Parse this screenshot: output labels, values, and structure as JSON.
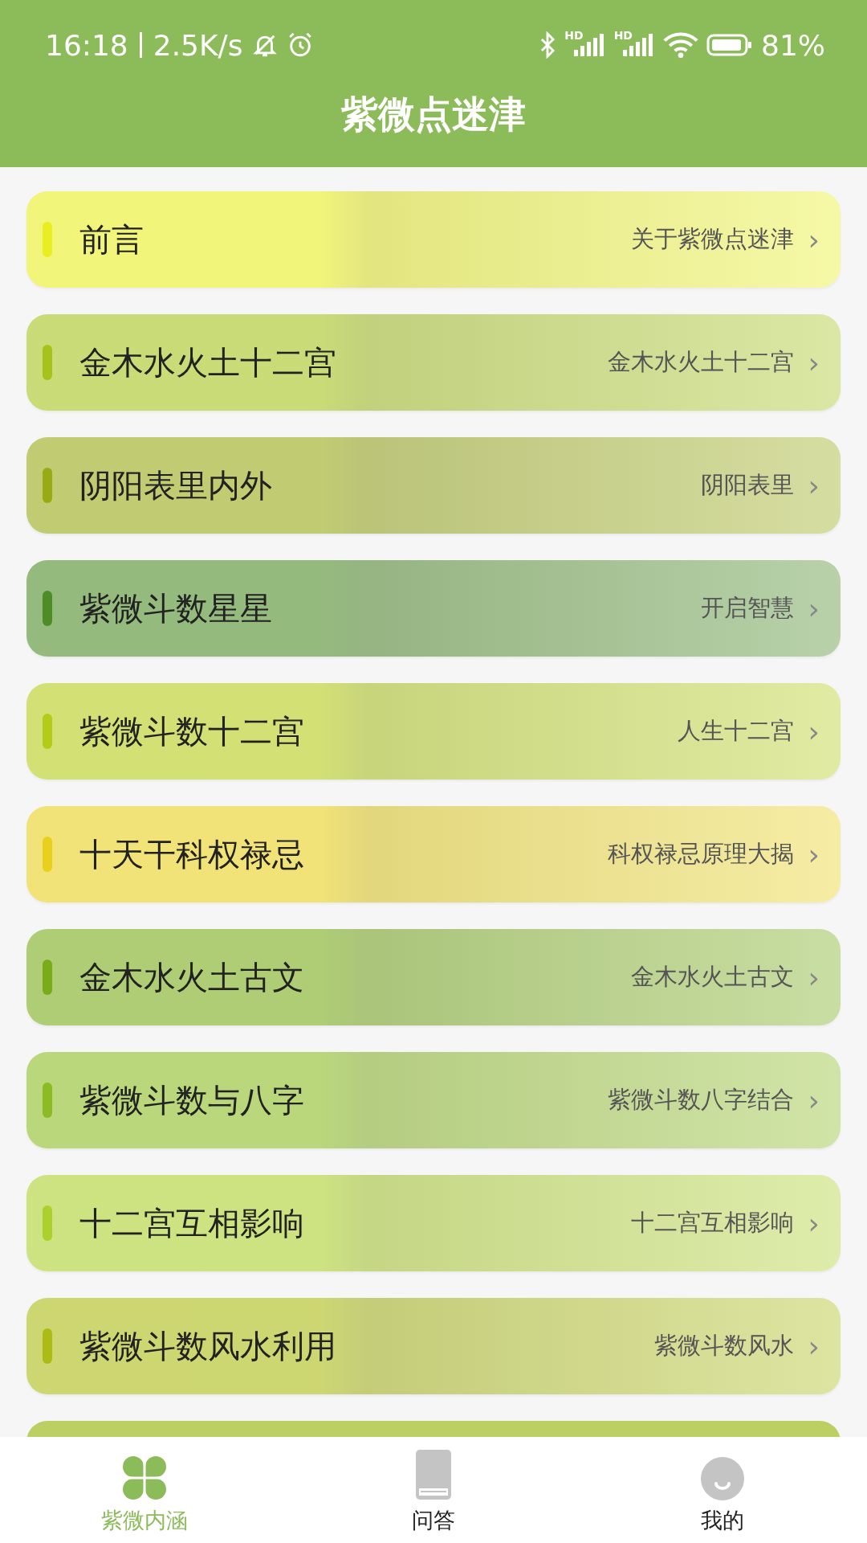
{
  "status_bar": {
    "time": "16:18",
    "speed": "2.5K/s",
    "signals": [
      {
        "label": "HD"
      },
      {
        "label": "HD"
      }
    ],
    "battery_level": "81%"
  },
  "header": {
    "title": "紫微点迷津"
  },
  "items": [
    {
      "kind": "entry",
      "title": "前言",
      "subtitle": "关于紫微点迷津",
      "chevron": "›",
      "color": "#e8ee20"
    },
    {
      "kind": "entry",
      "title": "金木水火土十二宫",
      "subtitle": "金木水火土十二宫",
      "chevron": "›",
      "color": "#a4c41c"
    },
    {
      "kind": "entry",
      "title": "阴阳表里内外",
      "subtitle": "阴阳表里",
      "chevron": "›",
      "color": "#98aa14"
    },
    {
      "kind": "entry",
      "title": "紫微斗数星星",
      "subtitle": "开启智慧",
      "chevron": "›",
      "color": "#4e8c28"
    },
    {
      "kind": "entry",
      "title": "紫微斗数十二宫",
      "subtitle": "人生十二宫",
      "chevron": "›",
      "color": "#b4cc18"
    },
    {
      "kind": "entry",
      "title": "十天干科权禄忌",
      "subtitle": "科权禄忌原理大揭",
      "chevron": "›",
      "color": "#e8d01c"
    },
    {
      "kind": "entry",
      "title": "金木水火土古文",
      "subtitle": "金木水火土古文",
      "chevron": "›",
      "color": "#78ac18"
    },
    {
      "kind": "entry",
      "title": "紫微斗数与八字",
      "subtitle": "紫微斗数八字结合",
      "chevron": "›",
      "color": "#8cbc24"
    },
    {
      "kind": "entry",
      "title": "十二宫互相影响",
      "subtitle": "十二宫互相影响",
      "chevron": "›",
      "color": "#acd02c"
    },
    {
      "kind": "entry",
      "title": "紫微斗数风水利用",
      "subtitle": "紫微斗数风水",
      "chevron": "›",
      "color": "#acbc14"
    },
    {
      "kind": "partial",
      "color": "#bccf62"
    }
  ],
  "tabs": [
    {
      "kind": "clover",
      "label": "紫微内涵",
      "selected": true
    },
    {
      "kind": "book",
      "label": "问答",
      "selected": false
    },
    {
      "kind": "face",
      "label": "我的",
      "selected": false
    }
  ]
}
